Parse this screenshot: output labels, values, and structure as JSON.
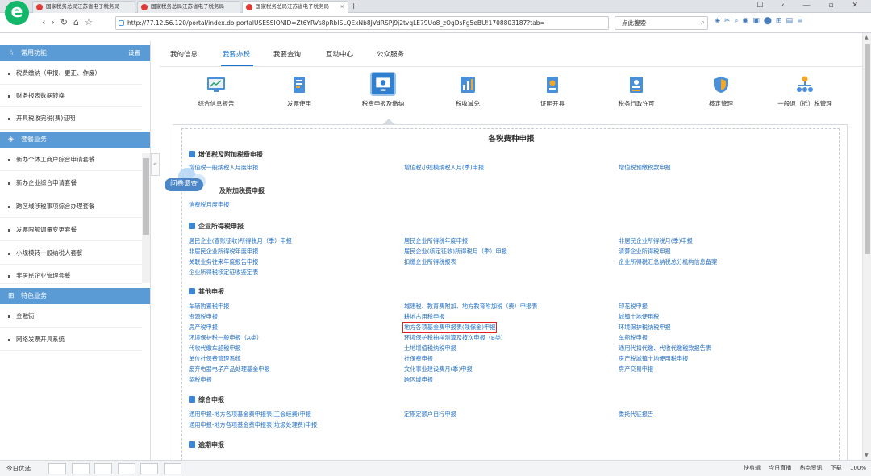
{
  "browser": {
    "tabs": [
      {
        "label": "国家税务总局江苏省电子税务局"
      },
      {
        "label": "国家税务总局江苏省电子税务局"
      },
      {
        "label": "国家税务总局江苏省电子税务局"
      }
    ],
    "url": "http://77.12.56.120/portal/index.do;portalUSESSIONID=Zt6YRVs8pRbISLQExNb8JVdRSPj9j2tvqLE79Uo8_zOgDsFg5eBU!1708803187?tab=",
    "search_placeholder": "点此搜索"
  },
  "sidebar": {
    "group1_title": "常用功能",
    "settings_label": "设置",
    "group1_items": [
      "税费缴纳（申报、更正、作废）",
      "财务报表数据转换",
      "开具税收完税(费)证明"
    ],
    "group2_title": "套餐业务",
    "group2_items": [
      "新办个体工商户综合申请套餐",
      "新办企业综合申请套餐",
      "跨区域涉税事项综合办理套餐",
      "发票限额调量变更套餐",
      "小规模转一般纳税人套餐",
      "非居民企业管理套餐"
    ],
    "group3_title": "特色业务",
    "group3_items": [
      "金融街",
      "网络发票开具系统"
    ]
  },
  "top_tabs": [
    "我的信息",
    "我要办税",
    "我要查询",
    "互动中心",
    "公众服务"
  ],
  "categories": [
    "综合信息报告",
    "发票使用",
    "税费申报及缴纳",
    "税收减免",
    "证明开具",
    "税务行政许可",
    "核定管理",
    "一般退（抵）税管理"
  ],
  "panel": {
    "title": "各税费种申报",
    "sections": [
      {
        "title": "增值税及附加税费申报",
        "links": [
          "增值税一般纳税人月度申报",
          "增值税小规模纳税人月(季)申报",
          "增值税预缴税款申报"
        ]
      },
      {
        "title": "及附加税费申报",
        "links": [
          "消费税月度申报"
        ]
      },
      {
        "title": "企业所得税申报",
        "links": [
          "居民企业(查账征收)所得税月（季）申报",
          "居民企业所得税年度申报",
          "非居民企业所得税月(季)申报",
          "非居民企业所得税年度申报",
          "居民企业(核定征收)所得税月（季）申报",
          "清算企业所得税申报",
          "关联业务往来年度报告申报",
          "扣缴企业所得税报表",
          "企业所得税汇总纳税总分机构信息备案",
          "企业所得税核定征收鉴定表"
        ]
      },
      {
        "title": "其他申报",
        "links": [
          "车辆购置税申报",
          "城建税、教育费附加、地方教育附加税（费）申报表",
          "印花税申报",
          "资源税申报",
          "耕地占用税申报",
          "城镇土地使用税",
          "房产税申报",
          "地方各项基金费申报表(残保金)申报",
          "环境保护税纳税申报",
          "环境保护税一般申报（A类）",
          "环境保护税抽样测算及按次申报（B类）",
          "车船税申报",
          "代收代缴车船税申报",
          "土地增值税纳税申报",
          "通用代扣代缴、代收代缴税款报告表",
          "单位社保费管理系统",
          "社保费申报",
          "房产税城镇土地使用税申报",
          "废弃电器电子产品处理基金申报",
          "文化事业建设费月(季)申报",
          "房产交易申报",
          "契税申报",
          "跨区域申报"
        ]
      },
      {
        "title": "综合申报",
        "links": [
          "通用申报-地方各项基金费申报表(工会经费)申报",
          "定期定额户自行申报",
          "委托代征报告",
          "通用申报-地方各项基金费申报表(垃圾处理费)申报"
        ]
      },
      {
        "title": "逾期申报",
        "links": []
      }
    ]
  },
  "survey_label": "问卷调查",
  "statusbar": {
    "left": "今日优选",
    "right": [
      "快剪辑",
      "今日直播",
      "热点资讯",
      "下载",
      "100%"
    ]
  },
  "colors": {
    "accent": "#5b9bd5",
    "link": "#2672c6",
    "highlight_box": "#e02424",
    "active_tab": "#1a73c8"
  }
}
